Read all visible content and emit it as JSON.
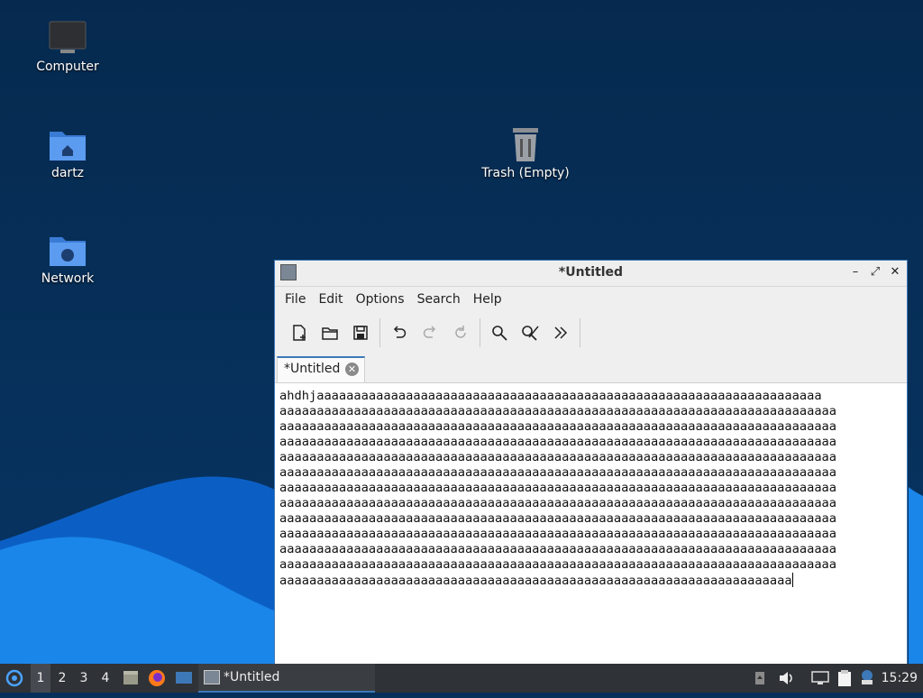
{
  "desktop": {
    "icons": [
      {
        "label": "Computer"
      },
      {
        "label": "dartz"
      },
      {
        "label": "Network"
      },
      {
        "label": "Trash (Empty)"
      }
    ]
  },
  "window": {
    "title": "*Untitled",
    "menu": [
      "File",
      "Edit",
      "Options",
      "Search",
      "Help"
    ],
    "tab_label": "*Untitled",
    "toolbar_icons": [
      "new-document-icon",
      "open-folder-icon",
      "save-icon",
      "undo-icon",
      "redo-icon",
      "reload-icon",
      "find-icon",
      "find-replace-icon",
      "more-icon"
    ],
    "lines": [
      "ahdhjaaaaaaaaaaaaaaaaaaaaaaaaaaaaaaaaaaaaaaaaaaaaaaaaaaaaaaaaaaaaaaaaaaaa",
      "aaaaaaaaaaaaaaaaaaaaaaaaaaaaaaaaaaaaaaaaaaaaaaaaaaaaaaaaaaaaaaaaaaaaaaaaaaa",
      "aaaaaaaaaaaaaaaaaaaaaaaaaaaaaaaaaaaaaaaaaaaaaaaaaaaaaaaaaaaaaaaaaaaaaaaaaaa",
      "aaaaaaaaaaaaaaaaaaaaaaaaaaaaaaaaaaaaaaaaaaaaaaaaaaaaaaaaaaaaaaaaaaaaaaaaaaa",
      "aaaaaaaaaaaaaaaaaaaaaaaaaaaaaaaaaaaaaaaaaaaaaaaaaaaaaaaaaaaaaaaaaaaaaaaaaaa",
      "aaaaaaaaaaaaaaaaaaaaaaaaaaaaaaaaaaaaaaaaaaaaaaaaaaaaaaaaaaaaaaaaaaaaaaaaaaa",
      "aaaaaaaaaaaaaaaaaaaaaaaaaaaaaaaaaaaaaaaaaaaaaaaaaaaaaaaaaaaaaaaaaaaaaaaaaaa",
      "aaaaaaaaaaaaaaaaaaaaaaaaaaaaaaaaaaaaaaaaaaaaaaaaaaaaaaaaaaaaaaaaaaaaaaaaaaa",
      "aaaaaaaaaaaaaaaaaaaaaaaaaaaaaaaaaaaaaaaaaaaaaaaaaaaaaaaaaaaaaaaaaaaaaaaaaaa",
      "aaaaaaaaaaaaaaaaaaaaaaaaaaaaaaaaaaaaaaaaaaaaaaaaaaaaaaaaaaaaaaaaaaaaaaaaaaa",
      "aaaaaaaaaaaaaaaaaaaaaaaaaaaaaaaaaaaaaaaaaaaaaaaaaaaaaaaaaaaaaaaaaaaaaaaaaaa",
      "aaaaaaaaaaaaaaaaaaaaaaaaaaaaaaaaaaaaaaaaaaaaaaaaaaaaaaaaaaaaaaaaaaaaaaaaaaa",
      "aaaaaaaaaaaaaaaaaaaaaaaaaaaaaaaaaaaaaaaaaaaaaaaaaaaaaaaaaaaaaaaaaaaaa"
    ]
  },
  "taskbar": {
    "workspaces": [
      "1",
      "2",
      "3",
      "4"
    ],
    "active_workspace": "1",
    "task_label": "*Untitled",
    "clock": "15:29"
  },
  "colors": {
    "accent": "#3d78b8",
    "desktop_bg": "#062a4f",
    "wave_light": "#1e8ff0",
    "wave_dark": "#0b5fc4",
    "taskbar_bg": "#2f3236"
  }
}
